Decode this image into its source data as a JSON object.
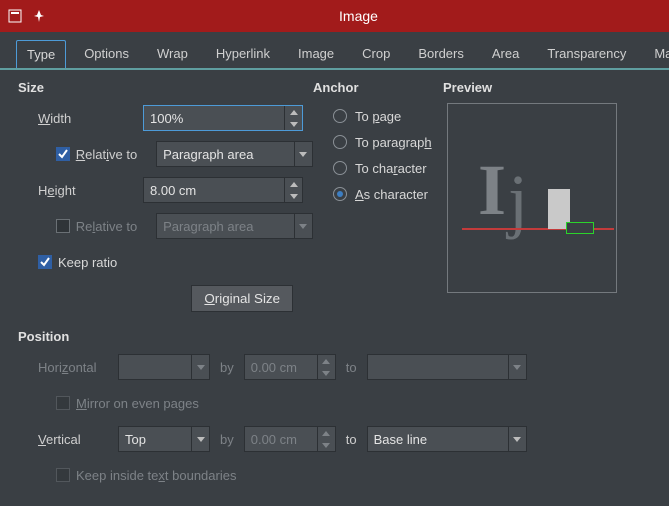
{
  "window": {
    "title": "Image"
  },
  "tabs": [
    "Type",
    "Options",
    "Wrap",
    "Hyperlink",
    "Image",
    "Crop",
    "Borders",
    "Area",
    "Transparency",
    "Macro"
  ],
  "size": {
    "title": "Size",
    "width_label": "Width",
    "width_value": "100%",
    "rel_width_label": "Relative to",
    "rel_width_value": "Paragraph area",
    "height_label": "Height",
    "height_value": "8.00 cm",
    "rel_height_label": "Relative to",
    "rel_height_value": "Paragraph area",
    "keep_ratio": "Keep ratio",
    "original_size": "Original Size"
  },
  "anchor": {
    "title": "Anchor",
    "to_page": "To page",
    "to_para": "To paragraph",
    "to_char": "To character",
    "as_char": "As character"
  },
  "preview": {
    "title": "Preview"
  },
  "position": {
    "title": "Position",
    "horiz_label": "Horizontal",
    "horiz_by": "by",
    "horiz_by_value": "0.00 cm",
    "horiz_to": "to",
    "mirror": "Mirror on even pages",
    "vert_label": "Vertical",
    "vert_value": "Top",
    "vert_by": "by",
    "vert_by_value": "0.00 cm",
    "vert_to": "to",
    "vert_to_value": "Base line",
    "keep_inside": "Keep inside text boundaries"
  }
}
